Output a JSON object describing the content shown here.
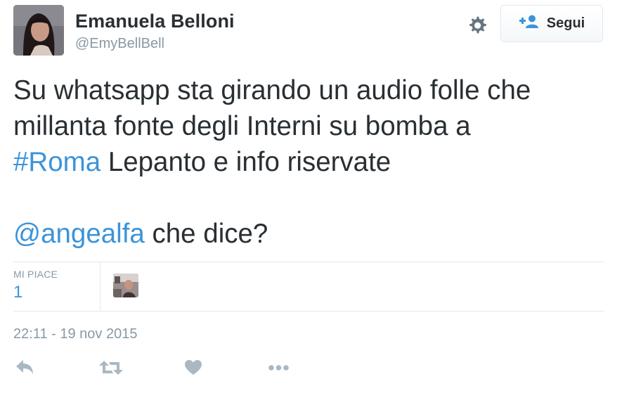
{
  "user": {
    "name": "Emanuela Belloni",
    "handle": "@EmyBellBell"
  },
  "follow_button": {
    "label": "Segui",
    "icon": "follow-user-plus-icon"
  },
  "settings": {
    "icon": "gear-icon"
  },
  "tweet": {
    "line1": "Su whatsapp sta girando un audio folle che",
    "line2": "millanta fonte degli Interni su bomba a",
    "hashtag_symbol": "#",
    "hashtag_text": "Roma",
    "line3_rest": " Lepanto e info riservate",
    "mention_symbol": "@",
    "mention_text": "angealfa",
    "line5_rest": " che dice?"
  },
  "stats": {
    "likes_label": "MI PIACE",
    "likes_count": "1"
  },
  "timestamp": "22:11 - 19 nov 2015",
  "actions": [
    {
      "name": "reply",
      "icon": "reply-icon"
    },
    {
      "name": "retweet",
      "icon": "retweet-icon"
    },
    {
      "name": "like",
      "icon": "heart-icon"
    },
    {
      "name": "more",
      "icon": "more-dots-icon"
    }
  ],
  "colors": {
    "text": "#292f33",
    "secondary": "#8899a6",
    "link": "#3b94d9",
    "divider": "#e1e8ed",
    "action_icon": "#aab8c2"
  }
}
